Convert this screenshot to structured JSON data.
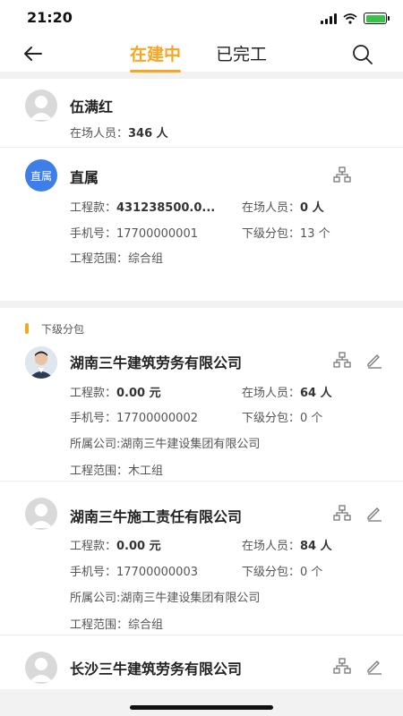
{
  "status": {
    "time": "21:20"
  },
  "nav": {
    "tab_active": "在建中",
    "tab_inactive": "已完工"
  },
  "summary": {
    "name": "伍满红",
    "onsite_label": "在场人员：",
    "onsite_value": "346 人"
  },
  "direct": {
    "badge": "直属",
    "title": "直属",
    "amount_label": "工程款：",
    "amount_value": "431238500.0...",
    "onsite_label": "在场人员：",
    "onsite_value": "0 人",
    "phone_label": "手机号：",
    "phone_value": "17700000001",
    "sub_label": "下级分包：",
    "sub_value": "13 个",
    "scope_label": "工程范围：",
    "scope_value": "综合组"
  },
  "section": {
    "label": "下级分包"
  },
  "subs": [
    {
      "name": "湖南三牛建筑劳务有限公司",
      "amount_label": "工程款：",
      "amount_value": "0.00 元",
      "onsite_label": "在场人员：",
      "onsite_value": "64 人",
      "phone_label": "手机号：",
      "phone_value": "17700000002",
      "sub_label": "下级分包：",
      "sub_value": "0 个",
      "company": "所属公司:湖南三牛建设集团有限公司",
      "scope_label": "工程范围：",
      "scope_value": "木工组"
    },
    {
      "name": "湖南三牛施工责任有限公司",
      "amount_label": "工程款：",
      "amount_value": "0.00 元",
      "onsite_label": "在场人员：",
      "onsite_value": "84 人",
      "phone_label": "手机号：",
      "phone_value": "17700000003",
      "sub_label": "下级分包：",
      "sub_value": "0 个",
      "company": "所属公司:湖南三牛建设集团有限公司",
      "scope_label": "工程范围：",
      "scope_value": "综合组"
    },
    {
      "name": "长沙三牛建筑劳务有限公司"
    }
  ],
  "colors": {
    "accent": "#f5a623",
    "badge": "#3d7ee8"
  },
  "icons": [
    "back-arrow-icon",
    "search-icon",
    "org-chart-icon",
    "edit-icon",
    "avatar-placeholder-icon"
  ]
}
